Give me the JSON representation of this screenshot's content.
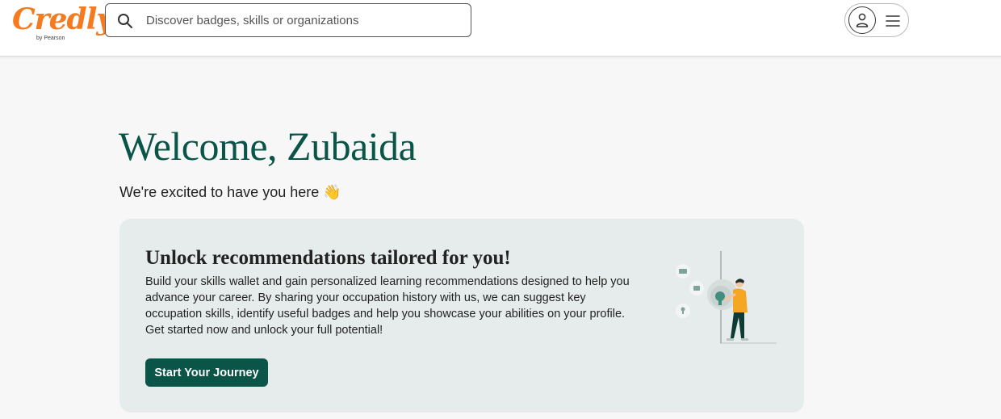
{
  "header": {
    "logo": {
      "wordmark": "Credly",
      "byline": "by Pearson"
    },
    "search": {
      "placeholder": "Discover badges, skills or organizations",
      "value": ""
    },
    "account": {
      "icons": [
        "user-icon",
        "hamburger-menu-icon"
      ]
    }
  },
  "main": {
    "welcome_title": "Welcome, Zubaida",
    "welcome_subtitle": "We're excited to have you here 👋",
    "card": {
      "title": "Unlock recommendations tailored for you!",
      "body": "Build your skills wallet and gain personalized learning recommendations designed to help you advance your career. By sharing your occupation history with us, we can suggest key occupation skills, identify useful badges and help you showcase your abilities on your profile. Get started now and unlock your full potential!",
      "cta_label": "Start Your Journey"
    }
  },
  "colors": {
    "brand_orange": "#f47b20",
    "brand_green": "#0b5548",
    "card_background": "#e6eceb",
    "page_background": "#f7f7f7",
    "illustration_yellow": "#f5a623"
  }
}
